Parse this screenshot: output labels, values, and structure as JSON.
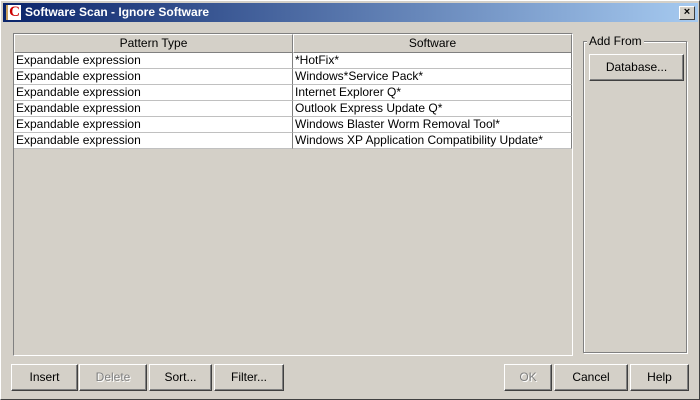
{
  "window": {
    "title": "Software Scan - Ignore Software",
    "close": "×",
    "icon": "C"
  },
  "table": {
    "headers": [
      "Pattern Type",
      "Software"
    ],
    "rows": [
      [
        "Expandable expression",
        "*HotFix*"
      ],
      [
        "Expandable expression",
        "Windows*Service Pack*"
      ],
      [
        "Expandable expression",
        "Internet Explorer Q*"
      ],
      [
        "Expandable expression",
        "Outlook Express Update Q*"
      ],
      [
        "Expandable expression",
        "Windows Blaster Worm Removal Tool*"
      ],
      [
        "Expandable expression",
        "Windows XP Application Compatibility Update*"
      ]
    ]
  },
  "add_from": {
    "label": "Add From",
    "database": "Database..."
  },
  "buttons": {
    "insert": "Insert",
    "delete": "Delete",
    "sort": "Sort...",
    "filter": "Filter...",
    "ok": "OK",
    "cancel": "Cancel",
    "help": "Help"
  }
}
